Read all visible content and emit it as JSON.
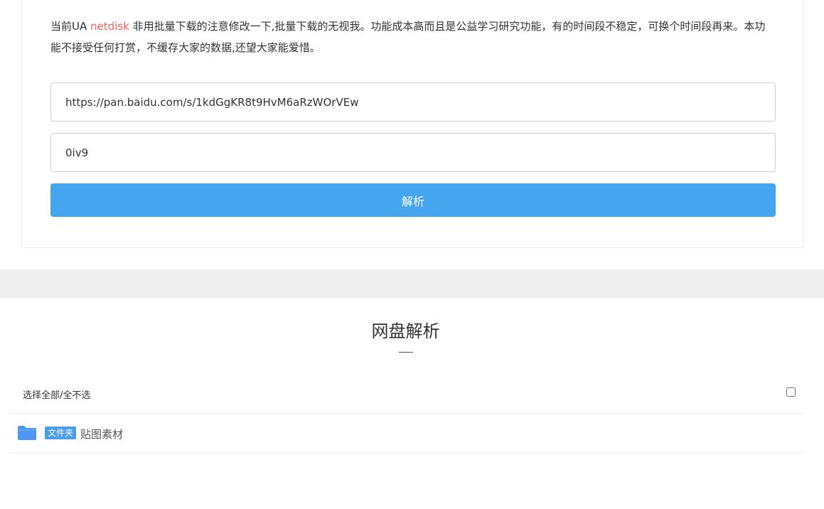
{
  "notice": {
    "prefix": "当前UA ",
    "ua_value": "netdisk",
    "text": " 非用批量下载的注意修改一下,批量下载的无视我。功能成本高而且是公益学习研究功能，有的时间段不稳定，可换个时间段再来。本功能不接受任何打赏，不缓存大家的数据,还望大家能爱惜。"
  },
  "form": {
    "url_value": "https://pan.baidu.com/s/1kdGgKR8t9HvM6aRzWOrVEw",
    "code_value": "0iv9",
    "parse_button_label": "解析"
  },
  "results": {
    "title": "网盘解析",
    "select_all_label": "选择全部/全不选",
    "select_all_checked": false,
    "files": [
      {
        "icon": "folder-icon",
        "badge": "文件夹",
        "name": "贴图素材"
      }
    ]
  },
  "colors": {
    "accent_button": "#44a4ed",
    "ua_highlight": "#f4625e",
    "folder_badge": "#4a9cf0",
    "folder_icon": "#4d96f5",
    "band": "#efefef"
  }
}
